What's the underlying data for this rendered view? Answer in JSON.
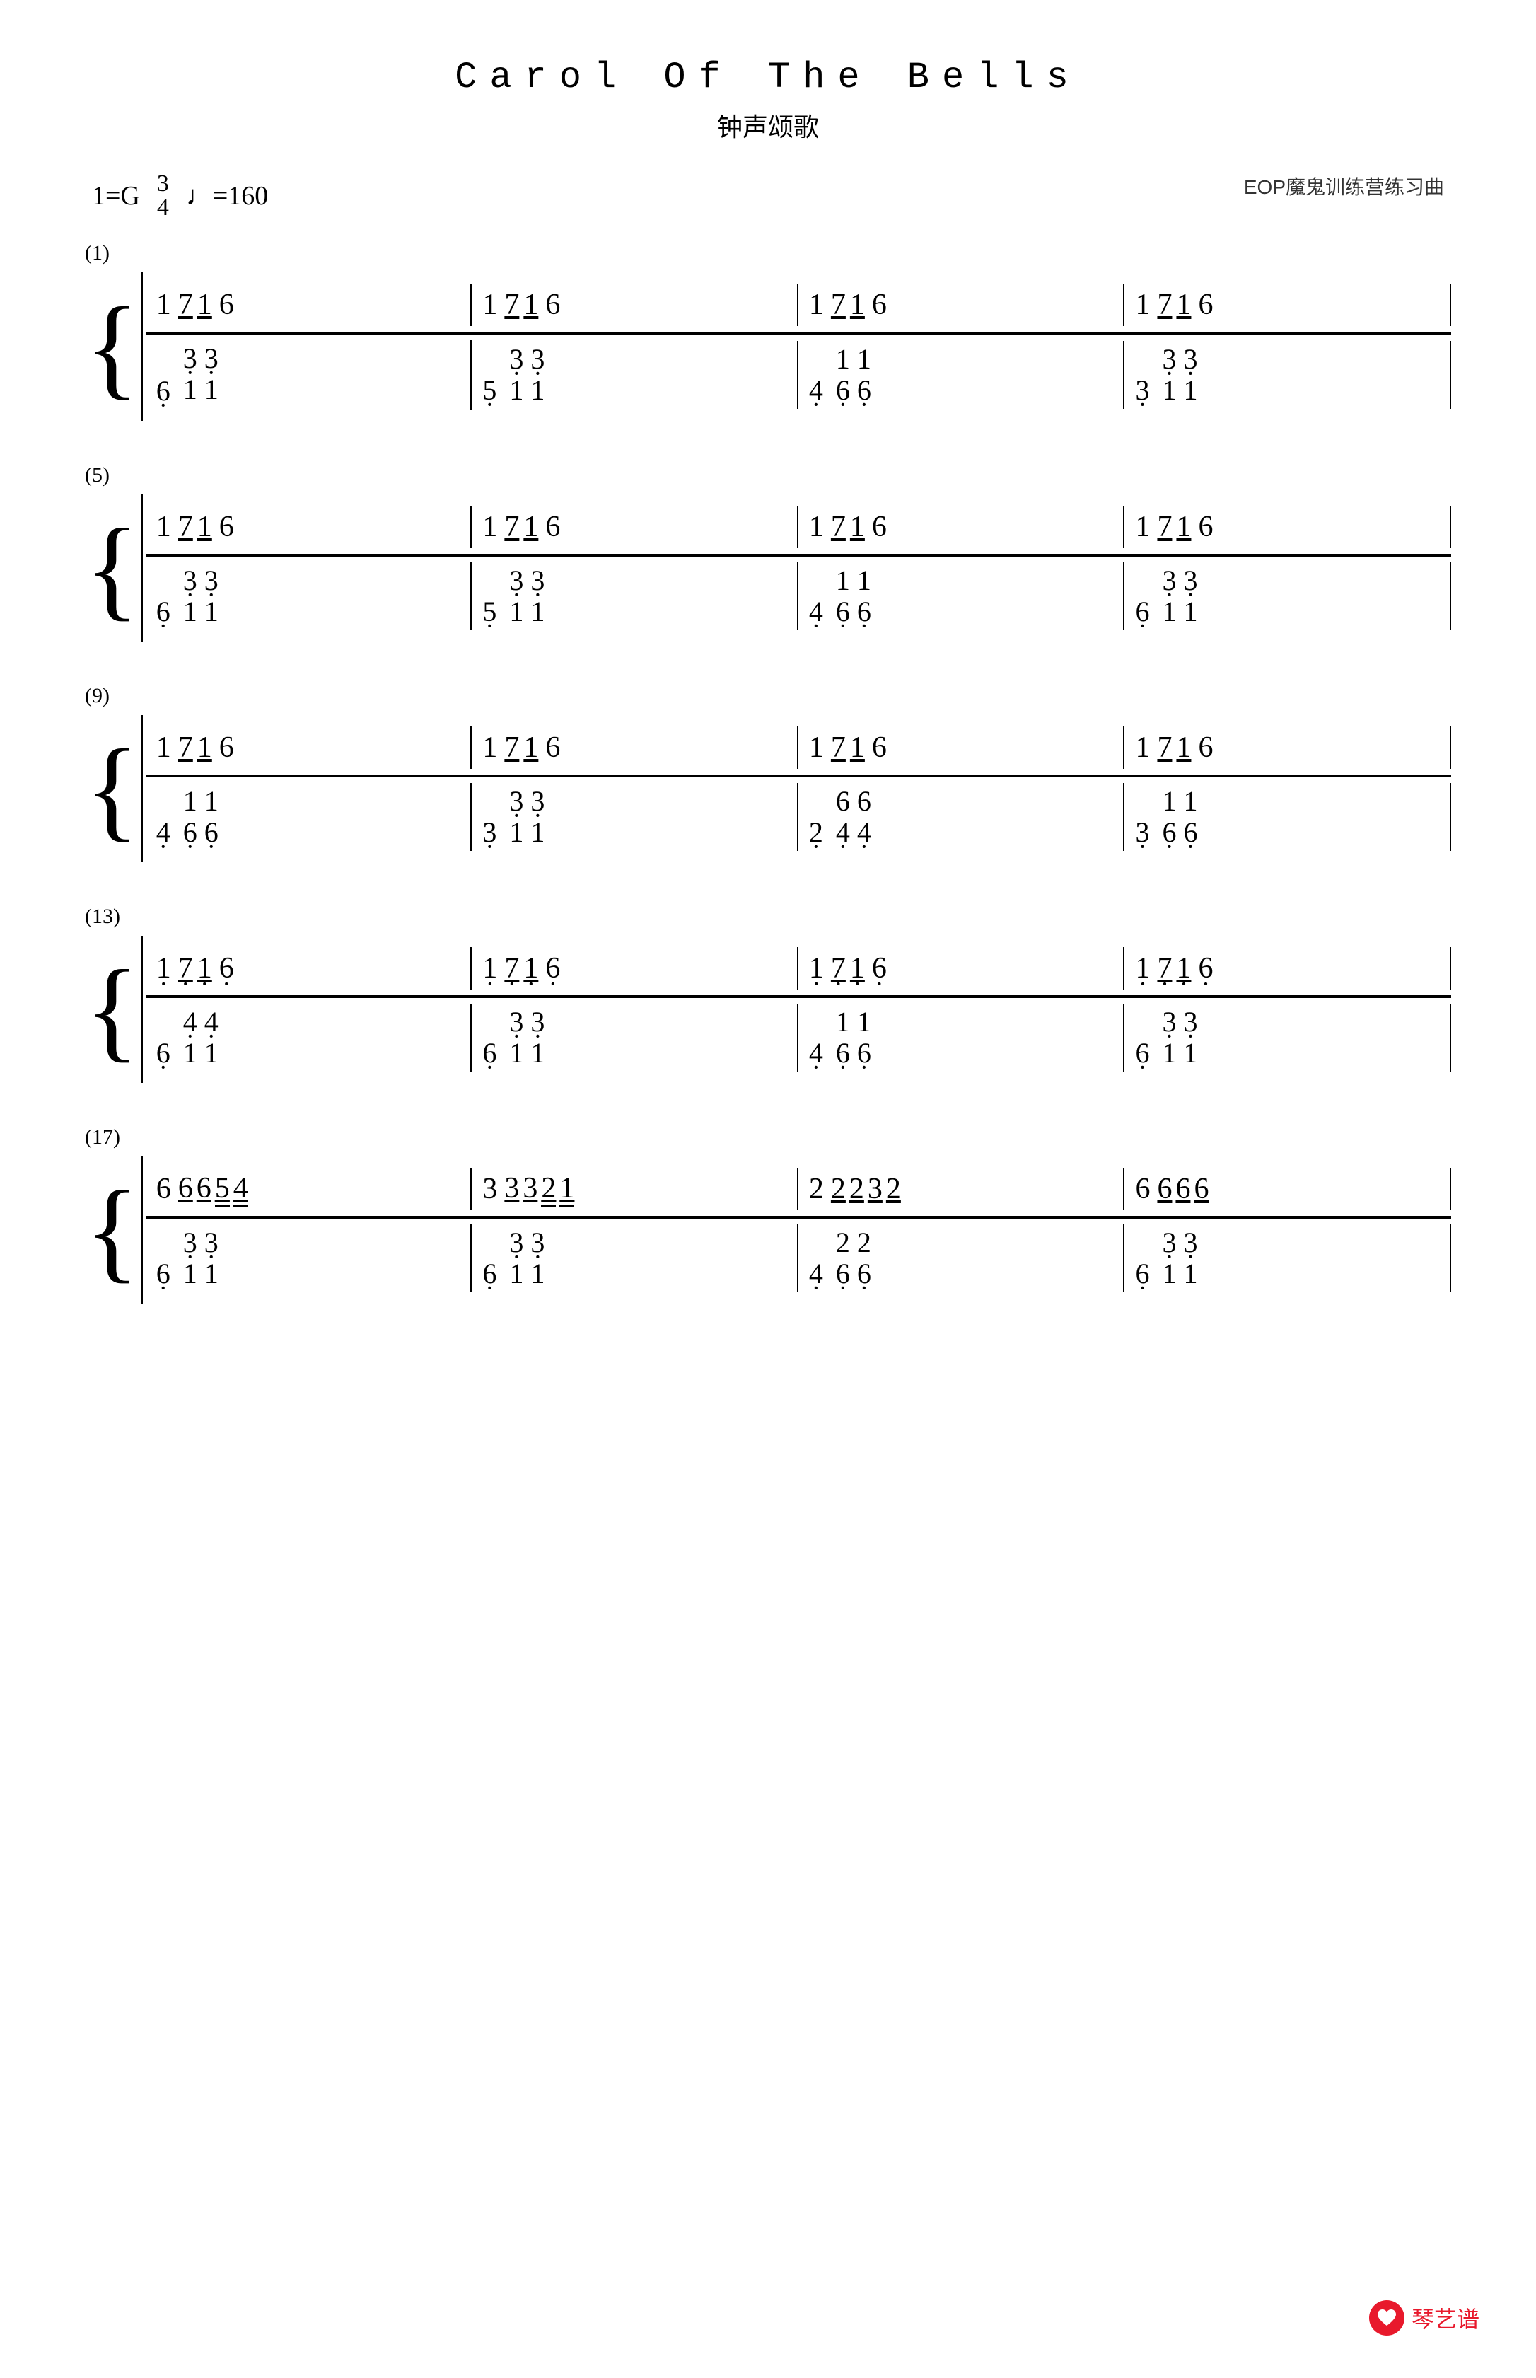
{
  "title": "Carol  Of  The  Bells",
  "subtitle": "钟声颂歌",
  "key": "1=G",
  "timeSig": {
    "num": "3",
    "den": "4"
  },
  "tempo": "♩=160",
  "watermark": "EOP魔鬼训练营练习曲",
  "logo": {
    "symbol": "♥",
    "text": "琴艺谱"
  },
  "sections": [
    {
      "label": "(1)"
    },
    {
      "label": "(5)"
    },
    {
      "label": "(9)"
    },
    {
      "label": "(13)"
    },
    {
      "label": "(17)"
    }
  ]
}
